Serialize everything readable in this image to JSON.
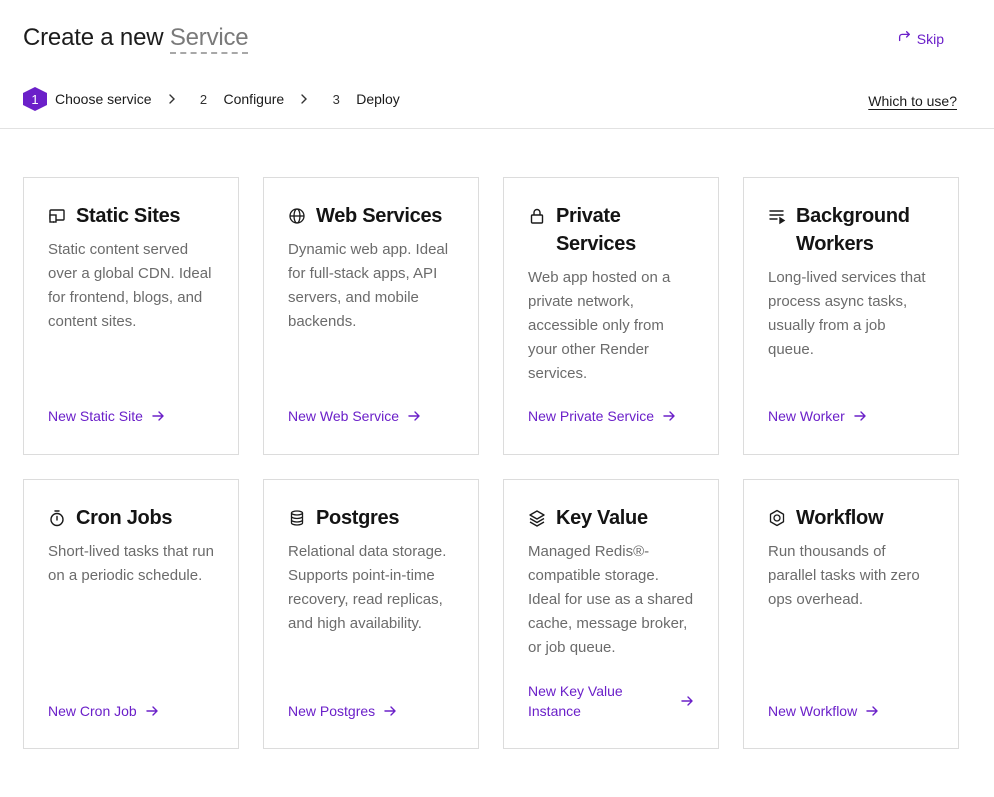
{
  "header": {
    "title_prefix": "Create a new",
    "title_highlight": "Service",
    "skip_label": "Skip",
    "which_link": "Which to use?"
  },
  "steps": [
    {
      "number": "1",
      "label": "Choose service",
      "active": true
    },
    {
      "number": "2",
      "label": "Configure",
      "active": false
    },
    {
      "number": "3",
      "label": "Deploy",
      "active": false
    }
  ],
  "cards": [
    {
      "icon": "static-site-icon",
      "title": "Static Sites",
      "description": "Static content served over a global CDN. Ideal for frontend, blogs, and content sites.",
      "link": "New Static Site"
    },
    {
      "icon": "globe-icon",
      "title": "Web Services",
      "description": "Dynamic web app. Ideal for full-stack apps, API servers, and mobile backends.",
      "link": "New Web Service"
    },
    {
      "icon": "lock-icon",
      "title": "Private Services",
      "description": "Web app hosted on a private network, accessible only from your other Render services.",
      "link": "New Private Service"
    },
    {
      "icon": "list-play-icon",
      "title": "Background Workers",
      "description": "Long-lived services that process async tasks, usually from a job queue.",
      "link": "New Worker"
    },
    {
      "icon": "stopwatch-icon",
      "title": "Cron Jobs",
      "description": "Short-lived tasks that run on a periodic schedule.",
      "link": "New Cron Job"
    },
    {
      "icon": "database-icon",
      "title": "Postgres",
      "description": "Relational data storage. Supports point-in-time recovery, read replicas, and high availability.",
      "link": "New Postgres"
    },
    {
      "icon": "layers-icon",
      "title": "Key Value",
      "description": "Managed Redis®-compatible storage. Ideal for use as a shared cache, message broker, or job queue.",
      "link": "New Key Value Instance"
    },
    {
      "icon": "workflow-icon",
      "title": "Workflow",
      "description": "Run thousands of parallel tasks with zero ops overhead.",
      "link": "New Workflow"
    }
  ],
  "colors": {
    "accent": "#6b20c9",
    "text": "#1a1a1a",
    "muted": "#6b6b6b",
    "border": "#dcdcdc"
  }
}
